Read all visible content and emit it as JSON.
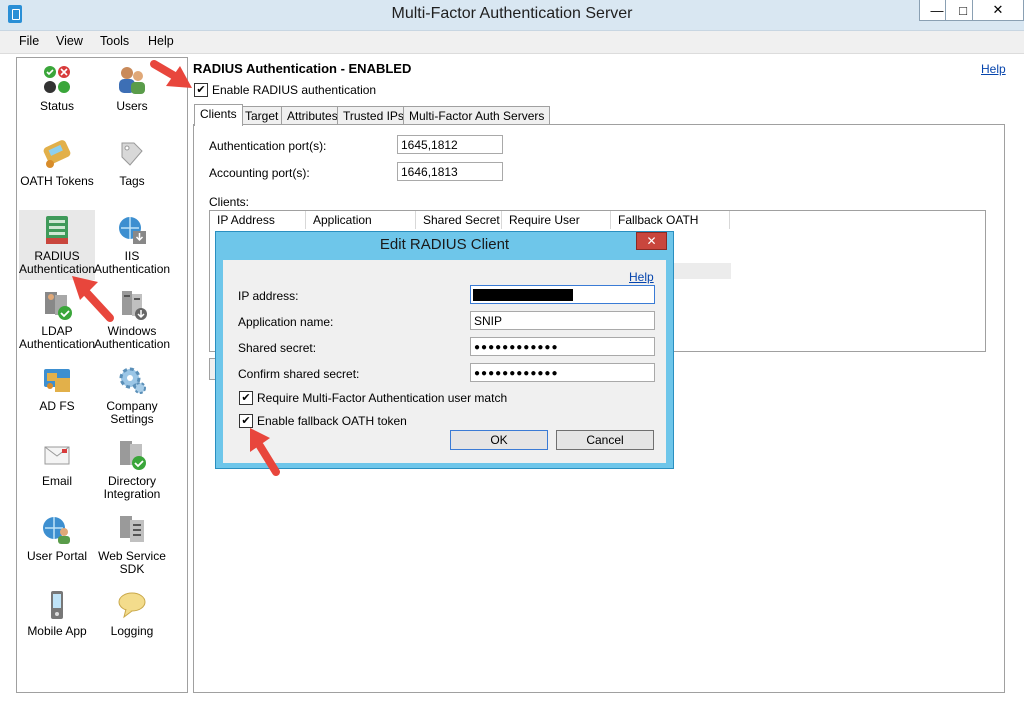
{
  "window": {
    "title": "Multi-Factor Authentication Server",
    "min_glyph": "—",
    "max_glyph": "□",
    "close_glyph": "✕"
  },
  "menu": {
    "items": [
      "File",
      "View",
      "Tools",
      "Help"
    ]
  },
  "nav": {
    "items": [
      {
        "label": "Status",
        "icon": "status-icon"
      },
      {
        "label": "Users",
        "icon": "users-icon"
      },
      {
        "label": "OATH Tokens",
        "icon": "oath-tokens-icon"
      },
      {
        "label": "Tags",
        "icon": "tags-icon"
      },
      {
        "label": "RADIUS Authentication",
        "icon": "radius-icon"
      },
      {
        "label": "IIS Authentication",
        "icon": "iis-icon"
      },
      {
        "label": "LDAP Authentication",
        "icon": "ldap-icon"
      },
      {
        "label": "Windows Authentication",
        "icon": "windows-auth-icon"
      },
      {
        "label": "AD FS",
        "icon": "adfs-icon"
      },
      {
        "label": "Company Settings",
        "icon": "company-settings-icon"
      },
      {
        "label": "Email",
        "icon": "email-icon"
      },
      {
        "label": "Directory Integration",
        "icon": "directory-icon"
      },
      {
        "label": "User Portal",
        "icon": "user-portal-icon"
      },
      {
        "label": "Web Service SDK",
        "icon": "sdk-icon"
      },
      {
        "label": "Mobile App",
        "icon": "mobile-app-icon"
      },
      {
        "label": "Logging",
        "icon": "logging-icon"
      }
    ]
  },
  "radius": {
    "heading": "RADIUS Authentication - ENABLED",
    "help": "Help",
    "enable_label": "Enable RADIUS authentication",
    "enable_checked": true,
    "tabs": [
      "Clients",
      "Target",
      "Attributes",
      "Trusted IPs",
      "Multi-Factor Auth Servers"
    ],
    "active_tab": "Clients",
    "auth_ports_label": "Authentication port(s):",
    "auth_ports_value": "1645,1812",
    "acct_ports_label": "Accounting port(s):",
    "acct_ports_value": "1646,1813",
    "clients_label": "Clients:",
    "columns": [
      "IP Address",
      "Application",
      "Shared Secret",
      "Require User Match",
      "Fallback OATH Token"
    ]
  },
  "dialog": {
    "title": "Edit RADIUS Client",
    "close_glyph": "✕",
    "help": "Help",
    "ip_label": "IP address:",
    "app_label": "Application name:",
    "app_value": "SNIP",
    "secret_label": "Shared secret:",
    "secret_value": "●●●●●●●●●●●●",
    "confirm_label": "Confirm shared secret:",
    "confirm_value": "●●●●●●●●●●●●",
    "require_match_label": "Require Multi-Factor Authentication user match",
    "require_match_checked": true,
    "fallback_label": "Enable fallback OATH token",
    "fallback_checked": true,
    "ok": "OK",
    "cancel": "Cancel",
    "check_glyph": "✔"
  },
  "colors": {
    "annotation_arrow": "#e8463c",
    "dialog_frame": "#6ec6ea",
    "close_button": "#c9463d"
  }
}
